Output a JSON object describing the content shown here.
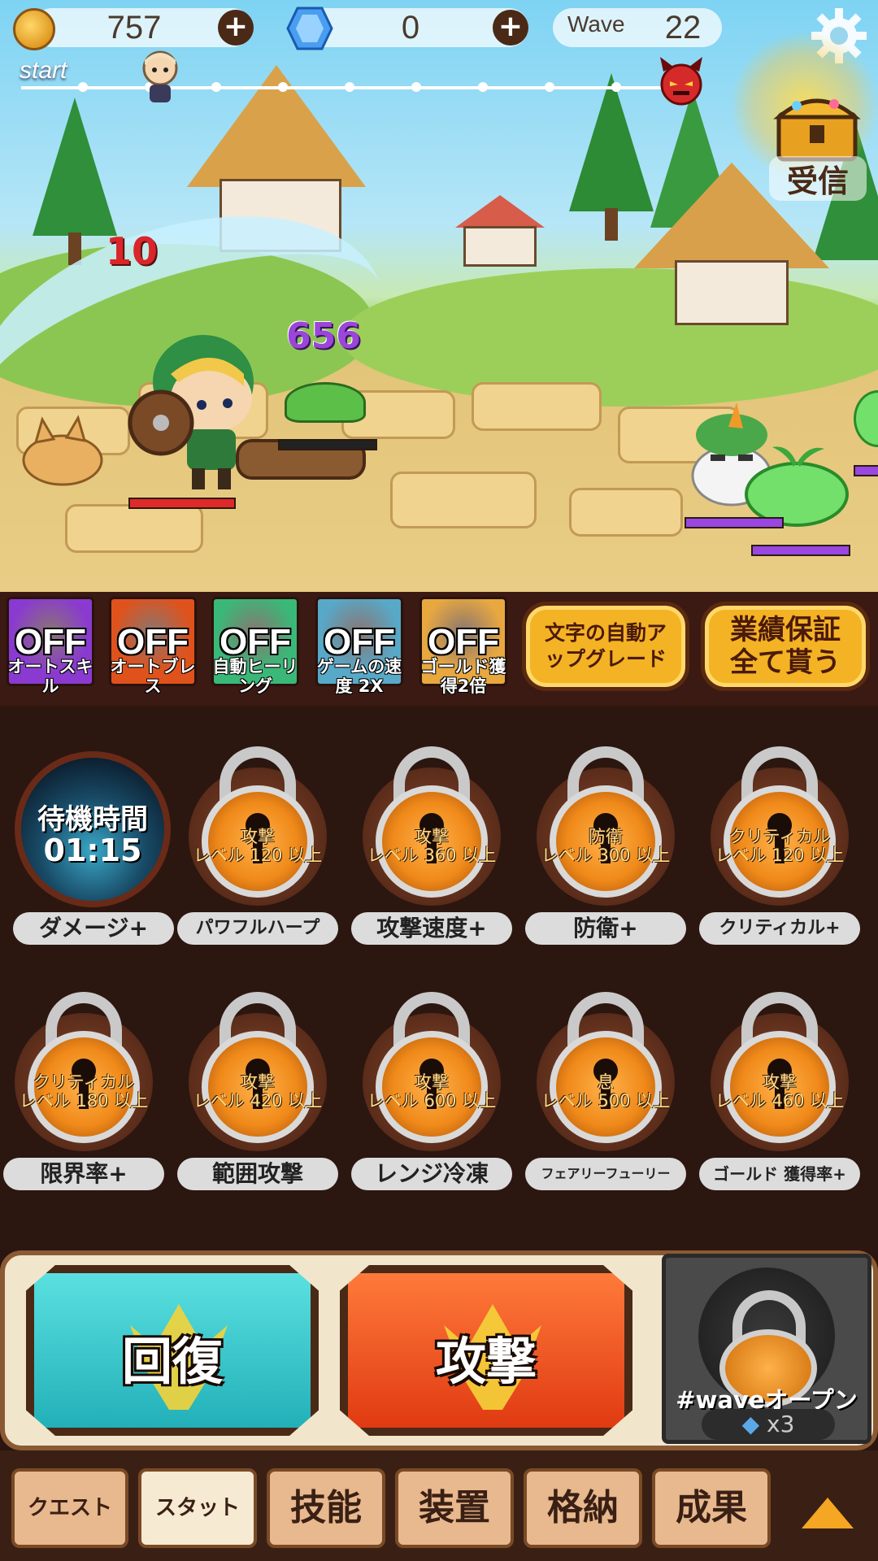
{
  "hud": {
    "gold": "757",
    "gems": "0",
    "wave_label": "Wave",
    "wave_number": "22",
    "progress_start": "start",
    "receive_label": "受信"
  },
  "battle": {
    "damage_red": "10",
    "damage_purple": "656"
  },
  "toggles": [
    {
      "state": "OFF",
      "label": "オートスキル",
      "color": "#8a3ad0"
    },
    {
      "state": "OFF",
      "label": "オートブレス",
      "color": "#e0521c"
    },
    {
      "state": "OFF",
      "label": "自動ヒーリング",
      "color": "#3ab878"
    },
    {
      "state": "OFF",
      "label": "ゲームの速度 2X",
      "color": "#58a8c8"
    },
    {
      "state": "OFF",
      "label": "ゴールド獲得2倍",
      "color": "#e8a840"
    }
  ],
  "gold_buttons": {
    "auto_upgrade": "文字の自動アップグレード",
    "collect_all": "業績保証全て貰う"
  },
  "stats_row1": {
    "timer_title": "待機時間",
    "timer_value": "01:15",
    "damage_label": "ダメージ+",
    "items": [
      {
        "req_stat": "攻撃",
        "req_level": "レベル 120 以上",
        "label": "パワフルハープ"
      },
      {
        "req_stat": "攻撃",
        "req_level": "レベル 360 以上",
        "label": "攻撃速度+"
      },
      {
        "req_stat": "防衛",
        "req_level": "レベル 300 以上",
        "label": "防衛+"
      },
      {
        "req_stat": "クリティカル",
        "req_level": "レベル 120 以上",
        "label": "クリティカル+"
      }
    ]
  },
  "stats_row2": [
    {
      "req_stat": "クリティカル",
      "req_level": "レベル 180 以上",
      "label": "限界率+"
    },
    {
      "req_stat": "攻撃",
      "req_level": "レベル 420 以上",
      "label": "範囲攻撃"
    },
    {
      "req_stat": "攻撃",
      "req_level": "レベル 600 以上",
      "label": "レンジ冷凍"
    },
    {
      "req_stat": "息",
      "req_level": "レベル 500 以上",
      "label": "フェアリーフューリー"
    },
    {
      "req_stat": "攻撃",
      "req_level": "レベル 460 以上",
      "label": "ゴールド 獲得率+"
    }
  ],
  "actions": {
    "heal_label": "回復",
    "attack_label": "攻撃",
    "locked_label": "#waveオープン",
    "locked_cost": "x3"
  },
  "tabs": [
    "クエスト",
    "スタット",
    "技能",
    "装置",
    "格納",
    "成果"
  ],
  "colors": {
    "heal": "#2fc4c4",
    "attack": "#ee4a1a",
    "gold_button": "#f4b225",
    "tab_active": "#f6ead2"
  }
}
